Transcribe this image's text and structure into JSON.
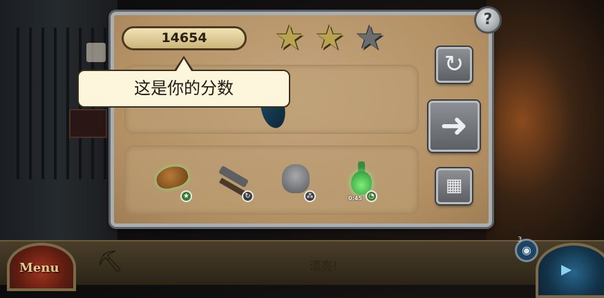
{
  "score": {
    "value": "14654"
  },
  "stars": {
    "earned": 2,
    "total": 3
  },
  "tooltip": {
    "text": "这是你的分数"
  },
  "items": [
    {
      "name": "hat",
      "badge": "star"
    },
    {
      "name": "revolver",
      "badge": "cycle"
    },
    {
      "name": "plague-mask",
      "badge": "triangle"
    },
    {
      "name": "potion",
      "badge": "timer",
      "timer_text": "0:45"
    }
  ],
  "buttons": {
    "help": "?",
    "replay_icon": "refresh-icon",
    "next_icon": "arrow-right-icon",
    "grid_icon": "grid-icon"
  },
  "bottom_bar": {
    "menu_label": "Menu",
    "status_text": "漂亮!",
    "camera_count": "3"
  },
  "colors": {
    "panel": "#b39064",
    "score_pill": "#e6d49d",
    "star_filled": "#b9a350",
    "star_empty": "#6a6d70"
  }
}
